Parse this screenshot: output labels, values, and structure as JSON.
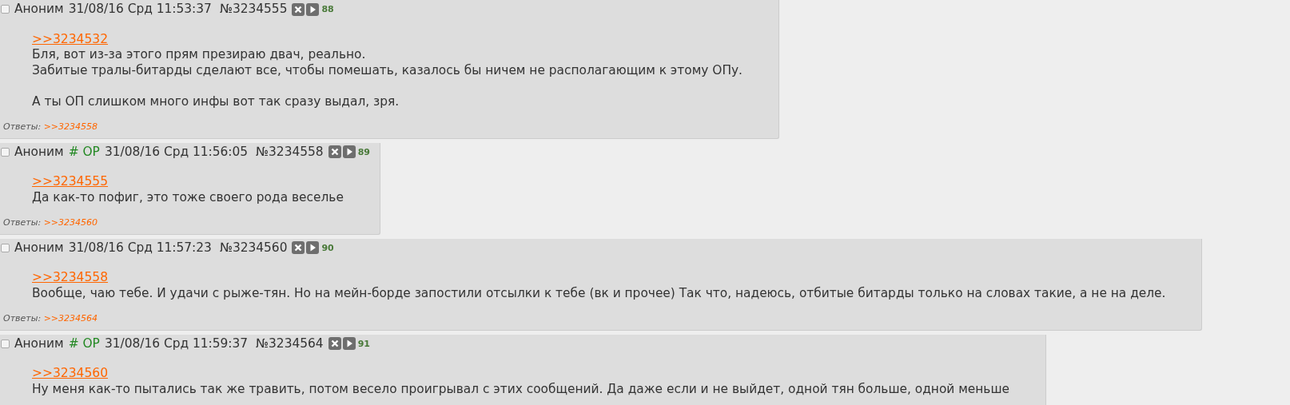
{
  "posts": [
    {
      "checked": false,
      "name": "Аноним",
      "date": "31/08/16 Срд 11:53:37",
      "number": "№3234555",
      "index": "88",
      "quote": ">>3234532",
      "paragraphs": [
        [
          "Бля, вот из-за этого прям презираю двач, реально.",
          "Забитые тралы-битарды сделают все, чтобы помешать, казалось бы ничем не располагающим к этому ОПу."
        ],
        [
          "А ты ОП слишком много инфы вот так сразу выдал, зря."
        ]
      ],
      "replies_label": "Ответы:",
      "replies": [
        ">>3234558"
      ]
    },
    {
      "checked": false,
      "name": "Аноним",
      "op_tag": "# OP",
      "date": "31/08/16 Срд 11:56:05",
      "number": "№3234558",
      "index": "89",
      "quote": ">>3234555",
      "paragraphs": [
        [
          "Да как-то пофиг, это тоже своего рода веселье"
        ]
      ],
      "replies_label": "Ответы:",
      "replies": [
        ">>3234560"
      ]
    },
    {
      "checked": false,
      "name": "Аноним",
      "date": "31/08/16 Срд 11:57:23",
      "number": "№3234560",
      "index": "90",
      "quote": ">>3234558",
      "paragraphs": [
        [
          "Вообще, чаю тебе. И удачи с рыже-тян. Но на мейн-борде запостили отсылки к тебе (вк и прочее) Так что, надеюсь, отбитые битарды только на словах такие, а не на деле."
        ]
      ],
      "replies_label": "Ответы:",
      "replies": [
        ">>3234564"
      ]
    },
    {
      "checked": false,
      "name": "Аноним",
      "op_tag": "# OP",
      "date": "31/08/16 Срд 11:59:37",
      "number": "№3234564",
      "index": "91",
      "quote": ">>3234560",
      "paragraphs": [
        [
          "Ну меня как-то пытались так же травить, потом весело проигрывал с этих сообщений. Да даже если и не выйдет, одной тян больше, одной меньше"
        ]
      ]
    }
  ]
}
